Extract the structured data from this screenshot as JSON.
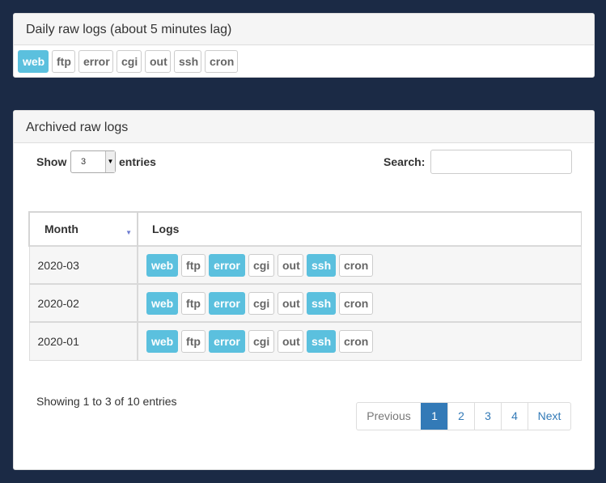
{
  "daily": {
    "title": "Daily raw logs (about 5 minutes lag)",
    "buttons": [
      "web",
      "ftp",
      "error",
      "cgi",
      "out",
      "ssh",
      "cron"
    ]
  },
  "archived": {
    "title": "Archived raw logs",
    "show_label": "Show",
    "show_value": "3",
    "entries_label": "entries",
    "search_label": "Search:",
    "search_value": "",
    "columns": [
      "Month",
      "Logs"
    ],
    "rows": [
      {
        "month": "2020-03",
        "logs": [
          "web",
          "ftp",
          "error",
          "cgi",
          "out",
          "ssh",
          "cron"
        ]
      },
      {
        "month": "2020-02",
        "logs": [
          "web",
          "ftp",
          "error",
          "cgi",
          "out",
          "ssh",
          "cron"
        ]
      },
      {
        "month": "2020-01",
        "logs": [
          "web",
          "ftp",
          "error",
          "cgi",
          "out",
          "ssh",
          "cron"
        ]
      }
    ],
    "info": "Showing 1 to 3 of 10 entries",
    "pagination": [
      "Previous",
      "1",
      "2",
      "3",
      "4",
      "Next"
    ]
  },
  "colors": {
    "background": "#1b2a45",
    "active_button": "#5bc0de",
    "page_active": "#337ab7"
  }
}
